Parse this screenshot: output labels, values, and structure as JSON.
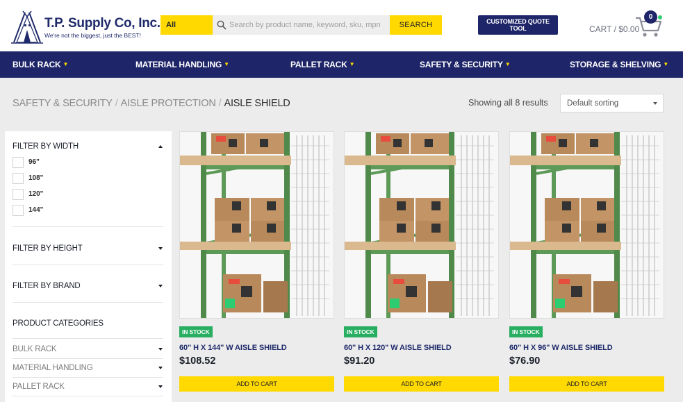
{
  "header": {
    "logo_name": "T.P. Supply Co, Inc.",
    "logo_tagline": "We're not the biggest, just the BEST!",
    "search_category": "All",
    "search_placeholder": "Search by product name, keyword, sku, mpn",
    "search_button": "SEARCH",
    "quote_button": "CUSTOMIZED QUOTE TOOL",
    "cart_label": "CART / $0.00",
    "cart_count": "0"
  },
  "nav": {
    "items": [
      {
        "label": "BULK RACK"
      },
      {
        "label": "MATERIAL HANDLING"
      },
      {
        "label": "PALLET RACK"
      },
      {
        "label": "SAFETY & SECURITY"
      },
      {
        "label": "STORAGE & SHELVING"
      }
    ]
  },
  "breadcrumb": {
    "items": [
      "SAFETY & SECURITY",
      "AISLE PROTECTION"
    ],
    "current": "AISLE SHIELD",
    "separator": "/"
  },
  "results_text": "Showing all 8 results",
  "sorting": {
    "selected": "Default sorting"
  },
  "sidebar": {
    "width_filter": {
      "title": "FILTER BY WIDTH",
      "options": [
        "96\"",
        "108\"",
        "120\"",
        "144\""
      ]
    },
    "height_filter": {
      "title": "FILTER BY HEIGHT"
    },
    "brand_filter": {
      "title": "FILTER BY BRAND"
    },
    "categories": {
      "title": "PRODUCT CATEGORIES",
      "items": [
        "BULK RACK",
        "MATERIAL HANDLING",
        "PALLET RACK"
      ]
    }
  },
  "products": [
    {
      "badge": "IN STOCK",
      "name": "60\" H X 144\" W AISLE SHIELD",
      "price": "$108.52",
      "button": "ADD TO CART"
    },
    {
      "badge": "IN STOCK",
      "name": "60\" H X 120\" W AISLE SHIELD",
      "price": "$91.20",
      "button": "ADD TO CART"
    },
    {
      "badge": "IN STOCK",
      "name": "60\" H X 96\" W AISLE SHIELD",
      "price": "$76.90",
      "button": "ADD TO CART"
    }
  ],
  "colors": {
    "brand_navy": "#1e2568",
    "accent_yellow": "#ffd900",
    "stock_green": "#27ae60"
  }
}
